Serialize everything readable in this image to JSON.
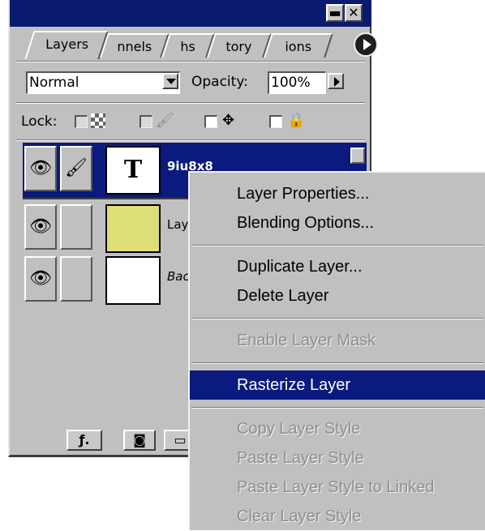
{
  "palette": {
    "tabs": [
      "Layers",
      "nnels",
      "hs",
      "tory",
      "ions"
    ],
    "blend_mode": "Normal",
    "opacity_label": "Opacity:",
    "opacity_value": "100%",
    "lock_label": "Lock:",
    "layers": [
      {
        "name": "9iu8x8",
        "thumb_text": "T",
        "selected": true
      },
      {
        "name": "Layer",
        "thumb_color": "#dede78"
      },
      {
        "name": "Back",
        "thumb_color": "#ffffff"
      }
    ],
    "titlebar_color": "#0a1a6e"
  },
  "context_menu": {
    "items": [
      {
        "label": "Layer Properties...",
        "state": "enabled"
      },
      {
        "label": "Blending Options...",
        "state": "enabled"
      },
      {
        "label": "Duplicate Layer...",
        "state": "enabled"
      },
      {
        "label": "Delete Layer",
        "state": "enabled"
      },
      {
        "label": "Enable Layer Mask",
        "state": "disabled"
      },
      {
        "label": "Rasterize Layer",
        "state": "highlighted"
      },
      {
        "label": "Copy Layer Style",
        "state": "disabled"
      },
      {
        "label": "Paste Layer Style",
        "state": "disabled"
      },
      {
        "label": "Paste Layer Style to Linked",
        "state": "disabled"
      },
      {
        "label": "Clear Layer Style",
        "state": "disabled"
      }
    ],
    "highlight_color": "#0a1a7e"
  }
}
